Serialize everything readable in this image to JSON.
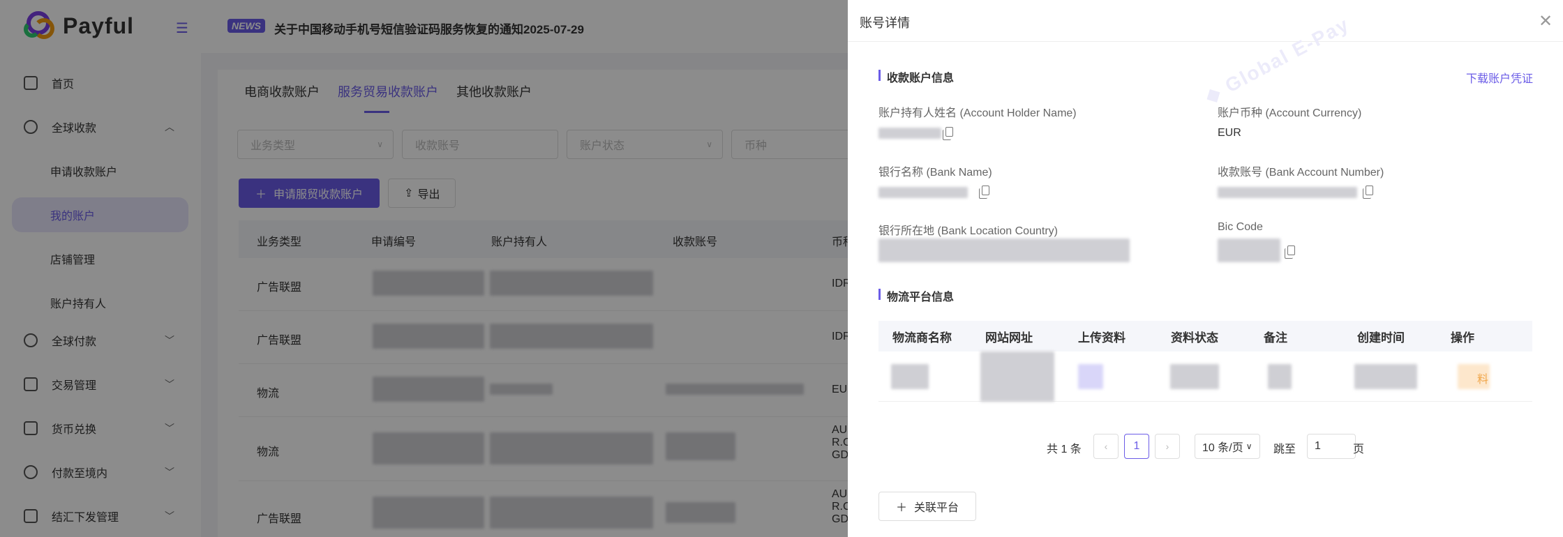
{
  "brand": {
    "name": "Payful"
  },
  "header": {
    "news_badge": "NEWS",
    "news_text": "关于中国移动手机号短信验证码服务恢复的通知2025-07-29"
  },
  "sidebar": {
    "items": [
      {
        "label": "首页"
      },
      {
        "label": "全球收款"
      },
      {
        "label": "申请收款账户"
      },
      {
        "label": "我的账户"
      },
      {
        "label": "店铺管理"
      },
      {
        "label": "账户持有人"
      },
      {
        "label": "全球付款"
      },
      {
        "label": "交易管理"
      },
      {
        "label": "货币兑换"
      },
      {
        "label": "付款至境内"
      },
      {
        "label": "结汇下发管理"
      }
    ]
  },
  "main": {
    "tabs": [
      "电商收款账户",
      "服务贸易收款账户",
      "其他收款账户"
    ],
    "filters": [
      "业务类型",
      "收款账号",
      "账户状态",
      "币种"
    ],
    "apply_button": "申请服贸收款账户",
    "export_button": "导出",
    "columns": [
      "业务类型",
      "申请编号",
      "账户持有人",
      "收款账号",
      "币种"
    ],
    "rows": [
      {
        "type": "广告联盟",
        "currency": "IDR"
      },
      {
        "type": "广告联盟",
        "currency": "IDR"
      },
      {
        "type": "物流",
        "currency": "EUR"
      },
      {
        "type": "物流",
        "currency": "AUD R.C GD"
      },
      {
        "type": "广告联盟",
        "currency": "AUD R.C GD"
      }
    ]
  },
  "drawer": {
    "title": "账号详情",
    "section_account": "收款账户信息",
    "download_link": "下载账户凭证",
    "fields": {
      "holder_name_label": "账户持有人姓名 (Account Holder Name)",
      "currency_label": "账户币种 (Account Currency)",
      "currency_value": "EUR",
      "bank_name_label": "银行名称 (Bank Name)",
      "account_number_label": "收款账号 (Bank Account Number)",
      "location_label": "银行所在地 (Bank Location Country)",
      "bic_label": "Bic Code"
    },
    "section_logistics": "物流平台信息",
    "table_columns": [
      "物流商名称",
      "网站网址",
      "上传资料",
      "资料状态",
      "备注",
      "创建时间",
      "操作"
    ],
    "op_link_fragment": "料",
    "pagination": {
      "total": "共 1 条",
      "current_page": "1",
      "page_size": "10 条/页",
      "jump_label": "跳至",
      "jump_value": "1",
      "page_suffix": "页"
    },
    "link_platform_button": "关联平台"
  },
  "colors": {
    "accent": "#6b5ce7",
    "warning": "#f0a64a"
  }
}
